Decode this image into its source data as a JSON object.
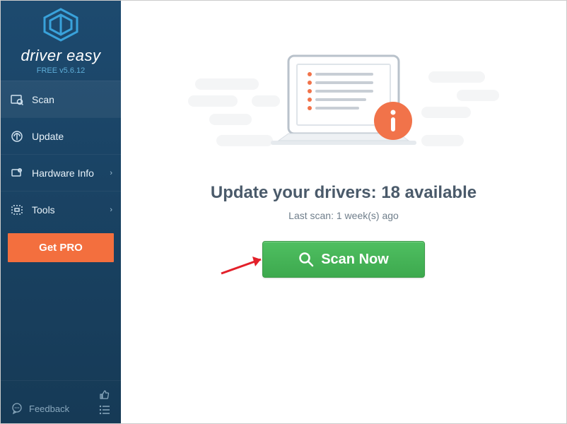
{
  "brand": {
    "name": "driver easy",
    "version": "FREE v5.6.12"
  },
  "nav": {
    "scan": "Scan",
    "update": "Update",
    "hardware": "Hardware Info",
    "tools": "Tools"
  },
  "getpro": {
    "label": "Get PRO"
  },
  "footer": {
    "feedback": "Feedback"
  },
  "main": {
    "headline_prefix": "Update your drivers: ",
    "available_count": "18",
    "headline_suffix": " available",
    "last_scan": "Last scan: 1 week(s) ago",
    "scan_button": "Scan Now"
  }
}
